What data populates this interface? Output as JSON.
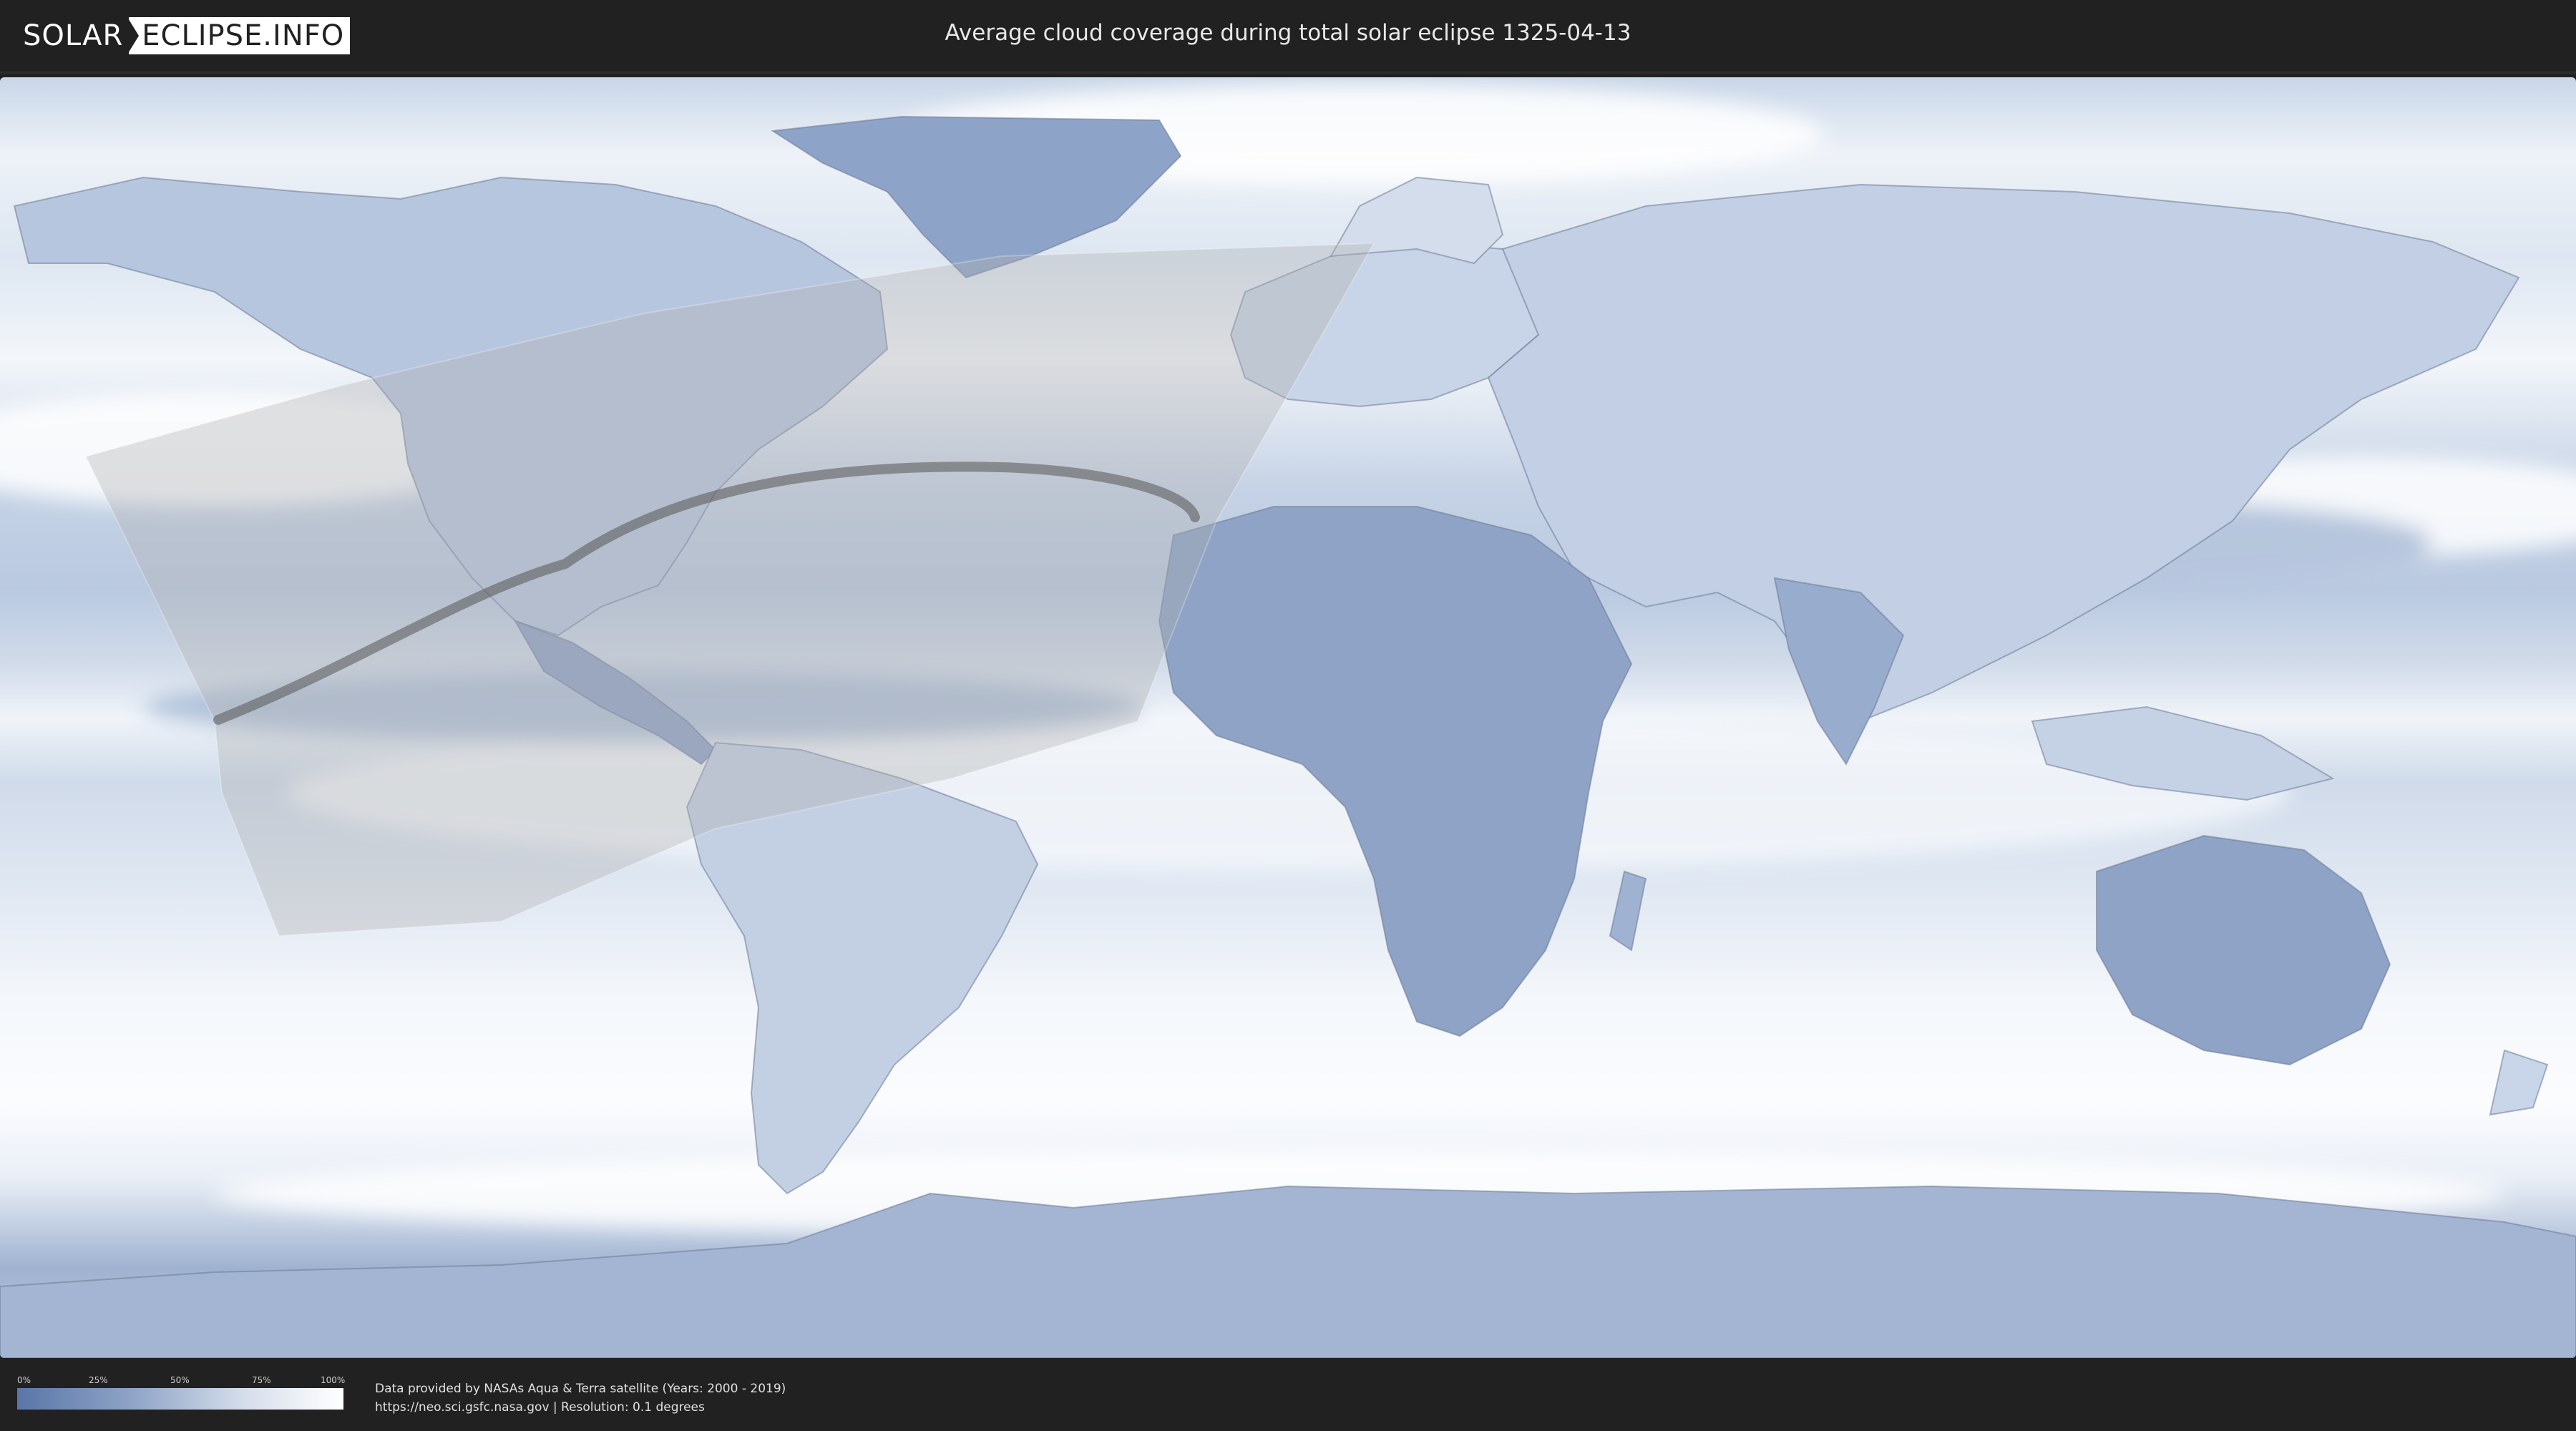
{
  "header": {
    "logo_part1": "SOLAR",
    "logo_part2": "ECLIPSE.INFO",
    "title": "Average cloud coverage during total solar eclipse 1325-04-13"
  },
  "map": {
    "layers": [
      "cloud-coverage",
      "country-borders",
      "eclipse-visibility-zone",
      "totality-path"
    ],
    "colors": {
      "clear": "#5a76a8",
      "cloudy": "#ffffff",
      "ocean_base": "#dfe7f2",
      "border": "#6b7a94",
      "visibility_zone": "#b0b0b0",
      "totality_path": "#555555"
    }
  },
  "legend": {
    "ticks": [
      "0%",
      "25%",
      "50%",
      "75%",
      "100%"
    ]
  },
  "credits": {
    "line1": "Data provided by NASAs Aqua & Terra satellite (Years: 2000 - 2019)",
    "line2": "https://neo.sci.gsfc.nasa.gov | Resolution: 0.1 degrees"
  }
}
